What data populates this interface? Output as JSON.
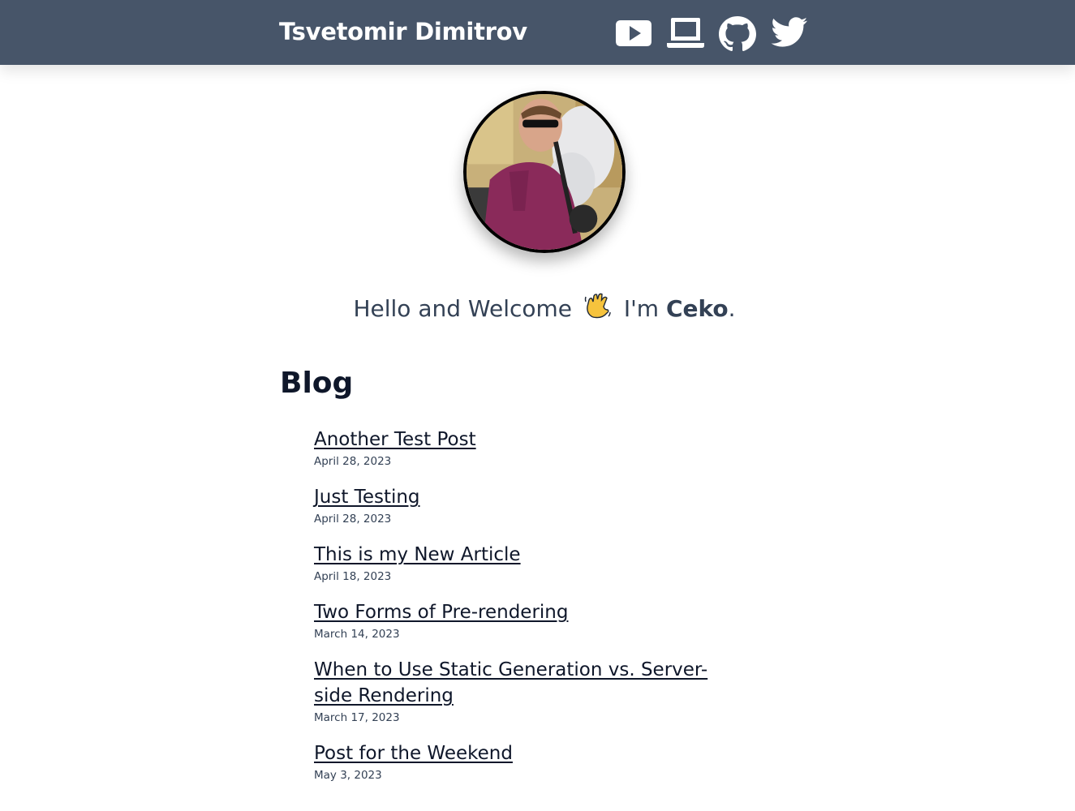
{
  "header": {
    "site_title": "Tsvetomir Dimitrov",
    "social_links": [
      {
        "icon": "youtube-icon"
      },
      {
        "icon": "laptop-icon"
      },
      {
        "icon": "github-icon"
      },
      {
        "icon": "twitter-icon"
      }
    ],
    "background_color": "#475569"
  },
  "hero": {
    "greeting": "Hello and Welcome",
    "emoji": "👋",
    "im_text": "I'm",
    "name": "Ceko",
    "period": "."
  },
  "blog": {
    "heading": "Blog",
    "posts": [
      {
        "title": "Another Test Post",
        "date": "April 28, 2023"
      },
      {
        "title": "Just Testing",
        "date": "April 28, 2023"
      },
      {
        "title": "This is my New Article",
        "date": "April 18, 2023"
      },
      {
        "title": "Two Forms of Pre-rendering",
        "date": "March 14, 2023"
      },
      {
        "title": "When to Use Static Generation vs. Server-side Rendering",
        "date": "March 17, 2023"
      },
      {
        "title": "Post for the Weekend",
        "date": "May 3, 2023"
      }
    ]
  }
}
